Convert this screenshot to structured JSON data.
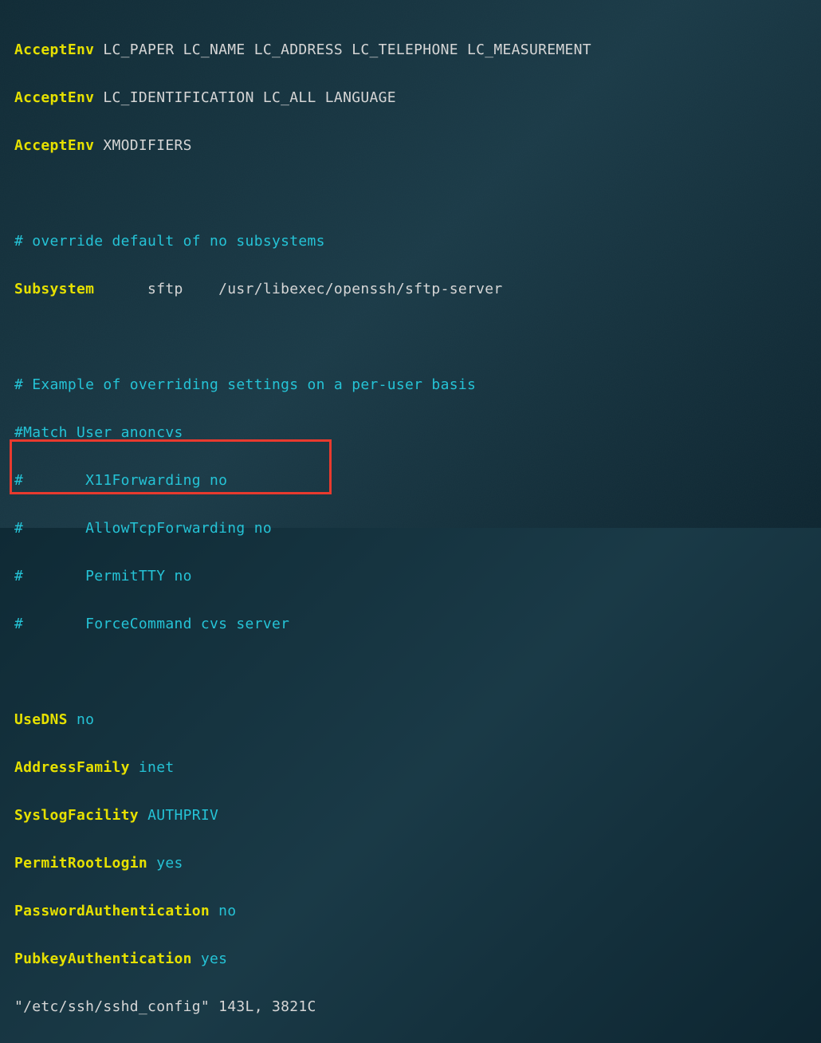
{
  "lines": {
    "l1_kw": "AcceptEnv",
    "l1_val": "LC_PAPER LC_NAME LC_ADDRESS LC_TELEPHONE LC_MEASUREMENT",
    "l2_kw": "AcceptEnv",
    "l2_val": "LC_IDENTIFICATION LC_ALL LANGUAGE",
    "l3_kw": "AcceptEnv",
    "l3_val": "XMODIFIERS",
    "l5_comment": "# override default of no subsystems",
    "l6_kw": "Subsystem",
    "l6_val": "      sftp    /usr/libexec/openssh/sftp-server",
    "l8_comment": "# Example of overriding settings on a per-user basis",
    "l9_comment": "#Match User anoncvs",
    "l10_comment": "#       X11Forwarding no",
    "l11_comment": "#       AllowTcpForwarding no",
    "l12_comment": "#       PermitTTY no",
    "l13_comment": "#       ForceCommand cvs server",
    "l15_kw": "UseDNS",
    "l15_val": "no",
    "l16_kw": "AddressFamily",
    "l16_val": "inet",
    "l17_kw": "SyslogFacility",
    "l17_val": "AUTHPRIV",
    "l18_kw": "PermitRootLogin",
    "l18_val": "yes",
    "l19_kw": "PasswordAuthentication",
    "l19_val": "no",
    "l20_kw": "PubkeyAuthentication",
    "l20_val": "yes"
  },
  "status": "\"/etc/ssh/sshd_config\" 143L, 3821C"
}
